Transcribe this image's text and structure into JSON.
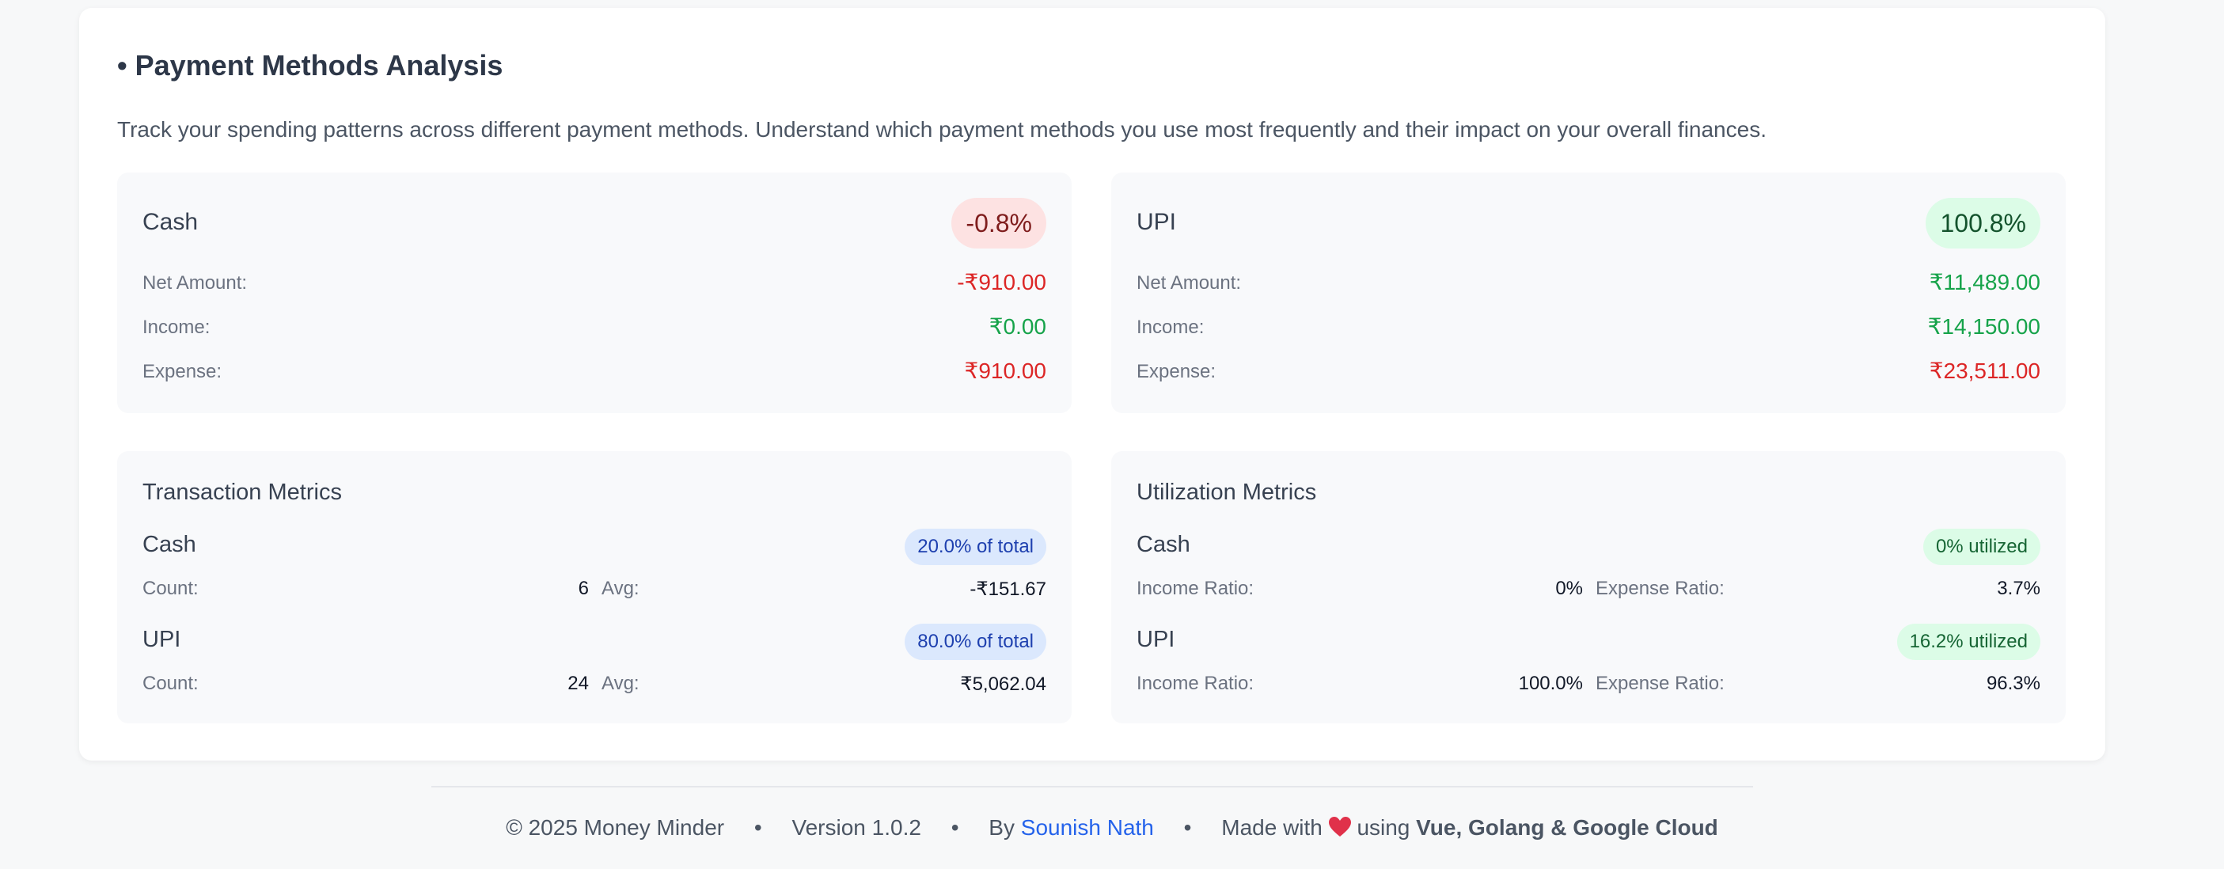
{
  "section": {
    "title": "• Payment Methods Analysis",
    "description": "Track your spending patterns across different payment methods. Understand which payment methods you use most frequently and their impact on your overall finances."
  },
  "methods": {
    "cash": {
      "name": "Cash",
      "change": "-0.8%",
      "net_label": "Net Amount:",
      "net_value": "-₹910.00",
      "income_label": "Income:",
      "income_value": "₹0.00",
      "expense_label": "Expense:",
      "expense_value": "₹910.00"
    },
    "upi": {
      "name": "UPI",
      "change": "100.8%",
      "net_label": "Net Amount:",
      "net_value": "₹11,489.00",
      "income_label": "Income:",
      "income_value": "₹14,150.00",
      "expense_label": "Expense:",
      "expense_value": "₹23,511.00"
    }
  },
  "transaction_metrics": {
    "title": "Transaction Metrics",
    "items": [
      {
        "name": "Cash",
        "badge": "20.0% of total",
        "count_label": "Count:",
        "count": "6",
        "avg_label": "Avg:",
        "avg": "-₹151.67"
      },
      {
        "name": "UPI",
        "badge": "80.0% of total",
        "count_label": "Count:",
        "count": "24",
        "avg_label": "Avg:",
        "avg": "₹5,062.04"
      }
    ]
  },
  "utilization_metrics": {
    "title": "Utilization Metrics",
    "items": [
      {
        "name": "Cash",
        "badge": "0% utilized",
        "income_label": "Income Ratio:",
        "income_ratio": "0%",
        "expense_label": "Expense Ratio:",
        "expense_ratio": "3.7%"
      },
      {
        "name": "UPI",
        "badge": "16.2% utilized",
        "income_label": "Income Ratio:",
        "income_ratio": "100.0%",
        "expense_label": "Expense Ratio:",
        "expense_ratio": "96.3%"
      }
    ]
  },
  "footer": {
    "copyright": "© 2025 Money Minder",
    "separator": "•",
    "version": "Version 1.0.2",
    "by_prefix": "By",
    "author": "Sounish Nath",
    "made_with": "Made with",
    "heart_icon": "heart-icon",
    "using": "using",
    "tech": "Vue, Golang & Google Cloud"
  },
  "colors": {
    "negative": "#dc2626",
    "positive": "#16a34a",
    "link": "#2563eb"
  }
}
